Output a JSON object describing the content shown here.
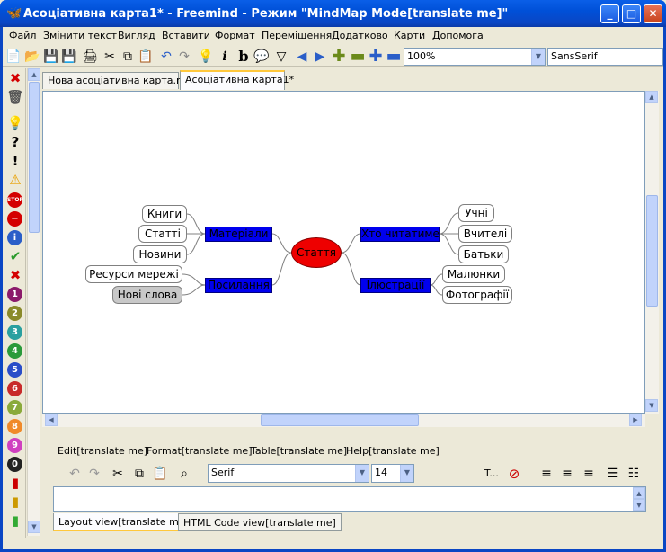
{
  "window": {
    "title": "Асоціативна карта1* - Freemind - Режим \"MindMap Mode[translate me]\""
  },
  "menu": [
    "Файл",
    "Змінити текст",
    "Вигляд",
    "Вставити",
    "Формат",
    "Переміщення",
    "Додатково",
    "Карти",
    "Допомога"
  ],
  "toolbar": {
    "zoom": "100%",
    "font": "SansSerif"
  },
  "tabs": [
    "Нова асоціативна карта.mm",
    "Асоціативна карта1*"
  ],
  "mindmap": {
    "root": "Стаття",
    "left": [
      {
        "label": "Матеріали",
        "children": [
          "Книги",
          "Статті",
          "Новини"
        ]
      },
      {
        "label": "Посилання",
        "children": [
          "Ресурси мережі",
          "Нові слова"
        ]
      }
    ],
    "right": [
      {
        "label": "Хто читатиме",
        "children": [
          "Учні",
          "Вчителі",
          "Батьки"
        ]
      },
      {
        "label": "Ілюстрації",
        "children": [
          "Малюнки",
          "Фотографії"
        ]
      }
    ]
  },
  "editor": {
    "menus": [
      "Edit[translate me]",
      "Format[translate me]",
      "Table[translate me]",
      "Help[translate me]"
    ],
    "font": "Serif",
    "size": "14",
    "text_label": "T...",
    "tabs": [
      "Layout view[translate me]",
      "HTML Code view[translate me]"
    ]
  },
  "numbered_icons": [
    "1",
    "2",
    "3",
    "4",
    "5",
    "6",
    "7",
    "8",
    "9",
    "0"
  ]
}
